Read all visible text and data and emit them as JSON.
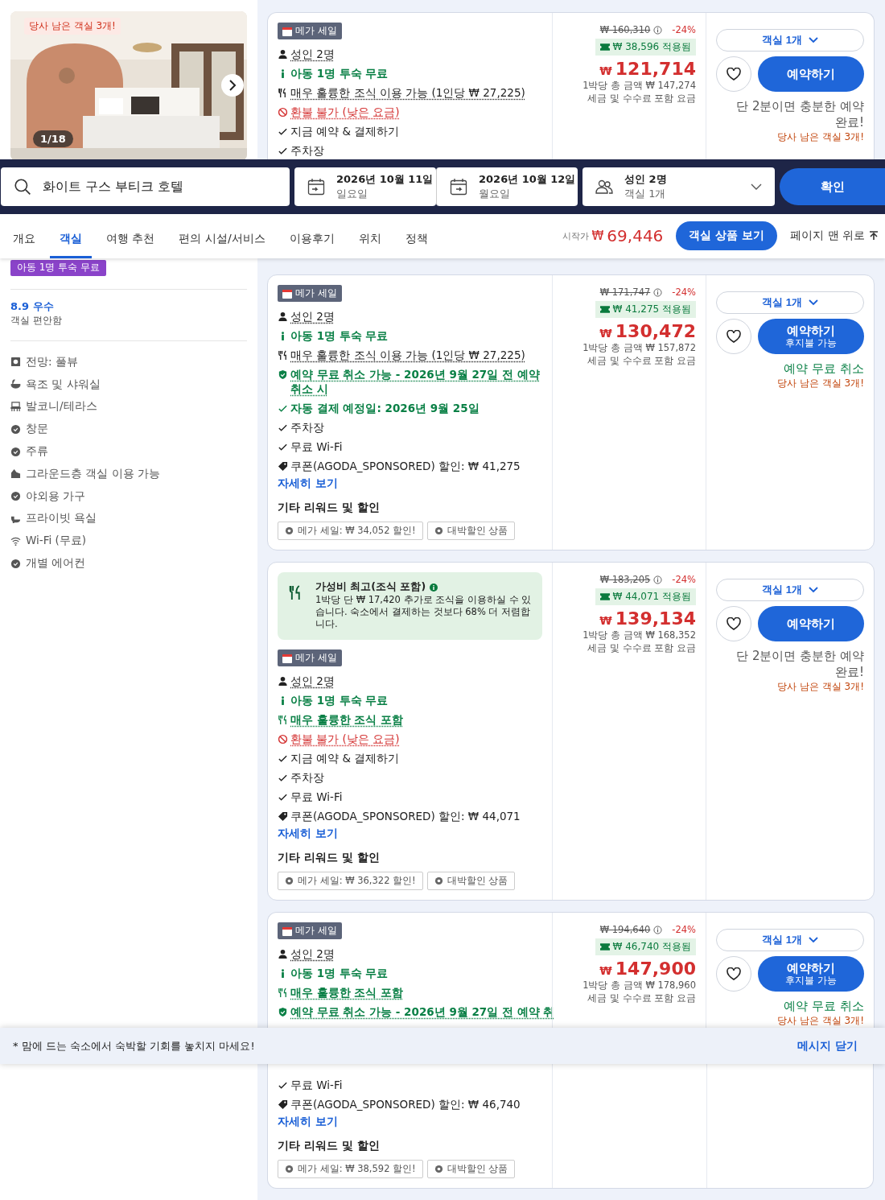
{
  "gallery": {
    "badge": "당사 남은 객실 3개!",
    "counter": "1/18"
  },
  "top_offer": {
    "sale_tag": "메가 세일",
    "features": [
      {
        "kind": "guests",
        "text": "성인 2명"
      },
      {
        "kind": "child",
        "text": "아동 1명 투숙 무료"
      },
      {
        "kind": "meal_option",
        "text": "매우 훌륭한 조식 이용 가능 (1인당 ₩ 27,225)"
      },
      {
        "kind": "refund",
        "text": "환불 불가 (낮은 요금)"
      },
      {
        "kind": "check",
        "text": "지금 예약 & 결제하기"
      },
      {
        "kind": "check",
        "text": "주차장"
      }
    ],
    "original_price": "₩ 160,310",
    "discount": "-24%",
    "applied": "₩ 38,596 적용됨",
    "currency": "₩",
    "price": "121,714",
    "total": "1박당 총 금액 ₩ 147,274",
    "tax_note": "세금 및 수수료 포함 요금",
    "room_select": "객실 1개",
    "book": "예약하기",
    "note": {
      "kind": "speed",
      "text": "단 2분이면 충분한 예약 완료!"
    },
    "availability": "당사 남은 객실 3개!"
  },
  "search_bar": {
    "destination": "화이트 구스 부티크 호텔",
    "check_in": {
      "date": "2026년 10월 11일",
      "weekday": "일요일"
    },
    "check_out": {
      "date": "2026년 10월 12일",
      "weekday": "월요일"
    },
    "guests": {
      "adults": "성인 2명",
      "rooms": "객실 1개"
    },
    "button": "확인"
  },
  "tabs": [
    {
      "label": "개요",
      "selected": false
    },
    {
      "label": "객실",
      "selected": true
    },
    {
      "label": "여행 추천",
      "selected": false
    },
    {
      "label": "편의 시설/서비스",
      "selected": false
    },
    {
      "label": "이용후기",
      "selected": false
    },
    {
      "label": "위치",
      "selected": false
    },
    {
      "label": "정책",
      "selected": false
    }
  ],
  "price_summary": {
    "prefix": "시작가",
    "currency": "₩",
    "price": "69,446",
    "button": "객실 상품 보기",
    "back_to_top": "페이지 맨 위로"
  },
  "sidebar": {
    "badge": "아동 1명 투숙 무료",
    "score": "8.9 우수",
    "score_caption": "객실 편안함",
    "amenities": [
      {
        "kind": "view",
        "label": "전망: 풀뷰"
      },
      {
        "kind": "bath",
        "label": "욕조 및 샤워실"
      },
      {
        "kind": "balcony",
        "label": "발코니/테라스"
      },
      {
        "kind": "check",
        "label": "창문"
      },
      {
        "kind": "check",
        "label": "주류"
      },
      {
        "kind": "floor",
        "label": "그라운드층 객실 이용 가능"
      },
      {
        "kind": "check",
        "label": "야외용 가구"
      },
      {
        "kind": "toilet",
        "label": "프라이빗 욕실"
      },
      {
        "kind": "wifi",
        "label": "Wi-Fi (무료)"
      },
      {
        "kind": "check",
        "label": "개별 에어컨"
      }
    ]
  },
  "offers": [
    {
      "sale_tag": "메가 세일",
      "features": [
        {
          "kind": "guests",
          "text": "성인 2명"
        },
        {
          "kind": "child",
          "text": "아동 1명 투숙 무료"
        },
        {
          "kind": "meal_option",
          "text": "매우 훌륭한 조식 이용 가능 (1인당 ₩ 27,225)"
        },
        {
          "kind": "cancel",
          "text": "예약 무료 취소 가능 - 2026년 9월 27일 전 예약 취소 시"
        },
        {
          "kind": "autopay",
          "text": "자동 결제 예정일: 2026년 9월 25일"
        },
        {
          "kind": "check",
          "text": "주차장"
        },
        {
          "kind": "check",
          "text": "무료 Wi-Fi"
        },
        {
          "kind": "coupon",
          "text": "쿠폰(AGODA_SPONSORED) 할인: ₩ 41,275"
        }
      ],
      "details_link": "자세히 보기",
      "rewards_title": "기타 리워드 및 할인",
      "rewards": [
        "메가 세일: ₩ 34,052 할인!",
        "대박할인 상품"
      ],
      "original_price": "₩ 171,747",
      "discount": "-24%",
      "applied": "₩ 41,275 적용됨",
      "currency": "₩",
      "price": "130,472",
      "total": "1박당 총 금액 ₩ 157,872",
      "tax_note": "세금 및 수수료 포함 요금",
      "room_select": "객실 1개",
      "book": "예약하기",
      "book_sub": "후지불 가능",
      "note": {
        "kind": "cancel",
        "text": "예약 무료 취소"
      },
      "availability": "당사 남은 객실 3개!"
    },
    {
      "value_banner": {
        "title": "가성비 최고(조식 포함)",
        "text": "1박당 단 ₩ 17,420 추가로 조식을 이용하실 수 있습니다. 숙소에서 결제하는 것보다 68% 더 저렴합니다."
      },
      "sale_tag": "메가 세일",
      "features": [
        {
          "kind": "guests",
          "text": "성인 2명"
        },
        {
          "kind": "child",
          "text": "아동 1명 투숙 무료"
        },
        {
          "kind": "meal_included",
          "text": "매우 훌륭한 조식 포함"
        },
        {
          "kind": "refund",
          "text": "환불 불가 (낮은 요금)"
        },
        {
          "kind": "check",
          "text": "지금 예약 & 결제하기"
        },
        {
          "kind": "check",
          "text": "주차장"
        },
        {
          "kind": "check",
          "text": "무료 Wi-Fi"
        },
        {
          "kind": "coupon",
          "text": "쿠폰(AGODA_SPONSORED) 할인: ₩ 44,071"
        }
      ],
      "details_link": "자세히 보기",
      "rewards_title": "기타 리워드 및 할인",
      "rewards": [
        "메가 세일: ₩ 36,322 할인!",
        "대박할인 상품"
      ],
      "original_price": "₩ 183,205",
      "discount": "-24%",
      "applied": "₩ 44,071 적용됨",
      "currency": "₩",
      "price": "139,134",
      "total": "1박당 총 금액 ₩ 168,352",
      "tax_note": "세금 및 수수료 포함 요금",
      "room_select": "객실 1개",
      "book": "예약하기",
      "note": {
        "kind": "speed",
        "text": "단 2분이면 충분한 예약 완료!"
      },
      "availability": "당사 남은 객실 3개!"
    }
  ],
  "last_offer": {
    "sale_tag": "메가 세일",
    "features": [
      {
        "kind": "guests",
        "text": "성인 2명"
      },
      {
        "kind": "child",
        "text": "아동 1명 투숙 무료"
      },
      {
        "kind": "meal_included",
        "text": "매우 훌륭한 조식 포함"
      },
      {
        "kind": "cancel",
        "text": "예약 무료 취소 가능 - 2026년 9월 27일 전 예약 취"
      }
    ],
    "features_below": [
      {
        "kind": "check",
        "text": "무료 Wi-Fi"
      },
      {
        "kind": "coupon",
        "text": "쿠폰(AGODA_SPONSORED) 할인: ₩ 46,740"
      }
    ],
    "details_link": "자세히 보기",
    "rewards_title": "기타 리워드 및 할인",
    "rewards": [
      "메가 세일: ₩ 38,592 할인!",
      "대박할인 상품"
    ],
    "original_price": "₩ 194,640",
    "discount": "-24%",
    "applied": "₩ 46,740 적용됨",
    "currency": "₩",
    "price": "147,900",
    "total": "1박당 총 금액 ₩ 178,960",
    "tax_note": "세금 및 수수료 포함 요금",
    "room_select": "객실 1개",
    "book": "예약하기",
    "book_sub": "후지불 가능",
    "note": {
      "kind": "cancel",
      "text": "예약 무료 취소"
    },
    "availability": "당사 남은 객실 3개!"
  },
  "message_bar": {
    "text": "* 맘에 드는 숙소에서 숙박할 기회를 놓치지 마세요!",
    "close": "메시지 닫기"
  }
}
